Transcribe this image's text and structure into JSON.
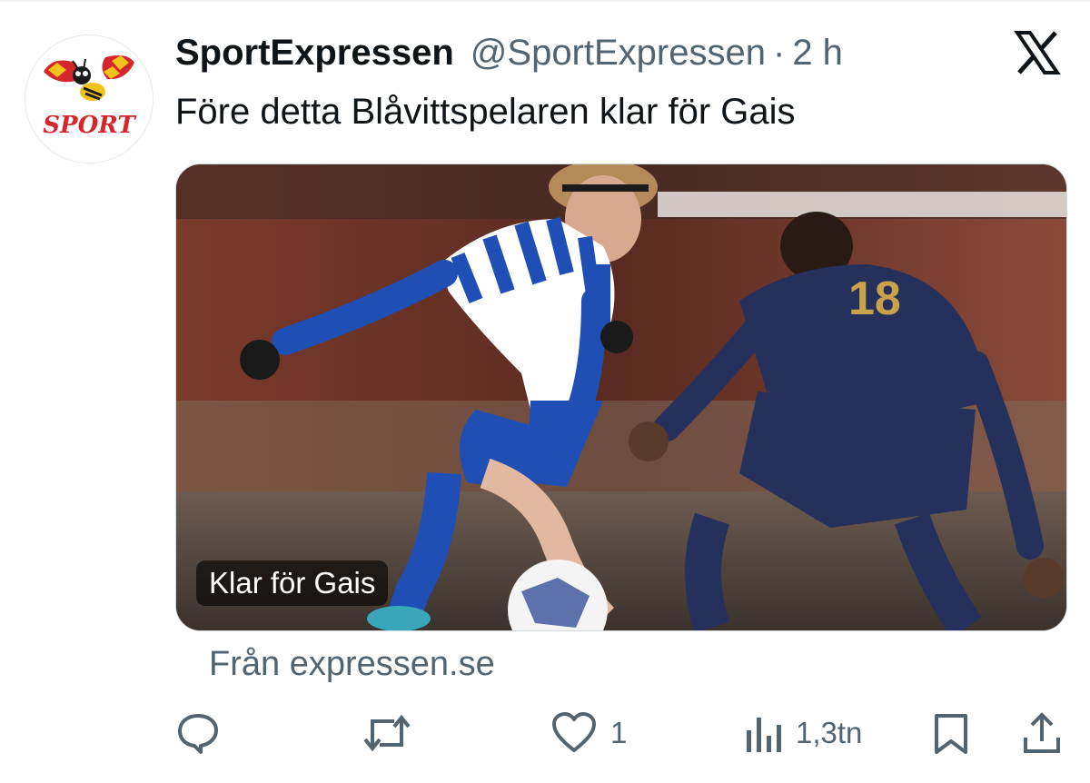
{
  "account": {
    "display_name": "SportExpressen",
    "handle": "@SportExpressen",
    "separator": "·",
    "time": "2 h",
    "avatar_text": "SPORT",
    "avatar_icon": "wasp-logo"
  },
  "tweet": {
    "text": "Före detta Blåvittspelaren klar för Gais"
  },
  "card": {
    "caption": "Klar för Gais",
    "source": "Från expressen.se"
  },
  "actions": {
    "reply": {
      "icon": "reply-icon",
      "count": ""
    },
    "retweet": {
      "icon": "retweet-icon",
      "count": ""
    },
    "like": {
      "icon": "heart-icon",
      "count": "1"
    },
    "views": {
      "icon": "views-icon",
      "count": "1,3tn"
    },
    "bookmark": {
      "icon": "bookmark-icon"
    },
    "share": {
      "icon": "share-icon"
    }
  },
  "colors": {
    "text": "#0f1419",
    "secondary": "#536471",
    "avatar_red": "#d4262c",
    "avatar_yellow": "#f2c21a"
  }
}
